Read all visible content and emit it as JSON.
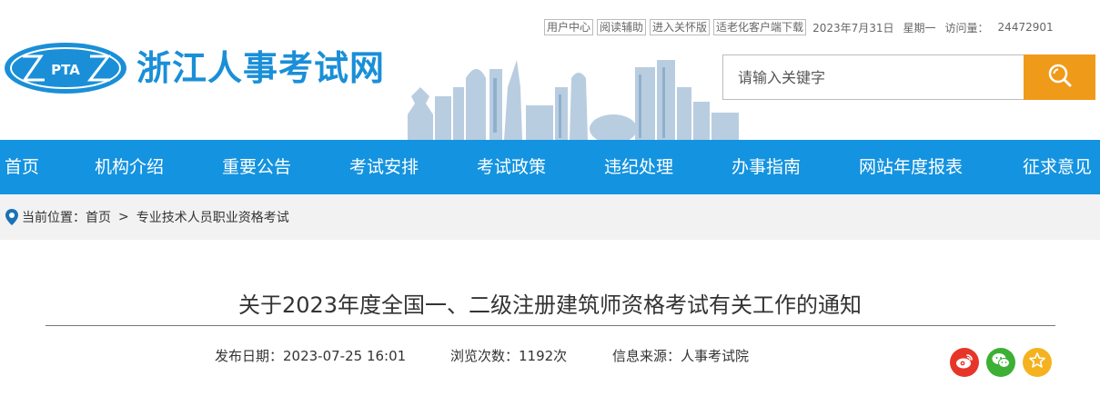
{
  "topbar": {
    "links": [
      "用户中心",
      "阅读辅助",
      "进入关怀版",
      "适老化客户端下载"
    ],
    "date": "2023年7月31日",
    "weekday": "星期一",
    "visits_label": "访问量：",
    "visits_count": "24472901"
  },
  "header": {
    "logo_text": "PTA",
    "site_title": "浙江人事考试网"
  },
  "search": {
    "placeholder": "请输入关键字",
    "icon": "search-icon"
  },
  "nav": {
    "items": [
      "首页",
      "机构介绍",
      "重要公告",
      "考试安排",
      "考试政策",
      "违纪处理",
      "办事指南",
      "网站年度报表",
      "征求意见"
    ]
  },
  "breadcrumb": {
    "label": "当前位置：",
    "home": "首页",
    "separator": ">",
    "current": "专业技术人员职业资格考试"
  },
  "article": {
    "title": "关于2023年度全国一、二级注册建筑师资格考试有关工作的通知",
    "pub_date": "发布日期：2023-07-25 16:01",
    "views": "浏览次数：1192次",
    "source": "信息来源：人事考试院"
  },
  "share": {
    "icons": [
      "weibo-icon",
      "wechat-icon",
      "favorite-icon"
    ]
  },
  "colors": {
    "brand_blue": "#1493e0",
    "search_orange": "#f09a1a",
    "weibo_red": "#e6362a",
    "wechat_green": "#3cb034",
    "fav_yellow": "#f5b220"
  }
}
